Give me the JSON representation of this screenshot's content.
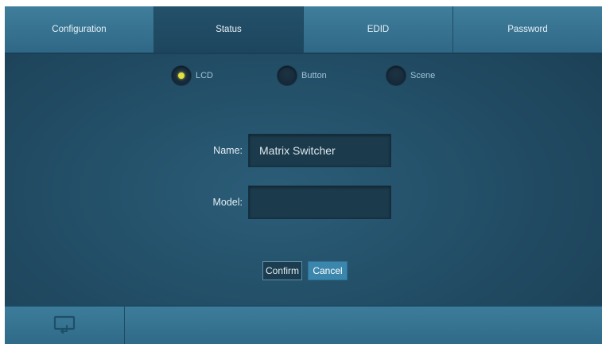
{
  "tabs": [
    {
      "label": "Configuration",
      "active": false
    },
    {
      "label": "Status",
      "active": true
    },
    {
      "label": "EDID",
      "active": false
    },
    {
      "label": "Password",
      "active": false
    }
  ],
  "radios": [
    {
      "label": "LCD",
      "selected": true
    },
    {
      "label": "Button",
      "selected": false
    },
    {
      "label": "Scene",
      "selected": false
    }
  ],
  "form": {
    "name_label": "Name:",
    "name_value": "Matrix Switcher",
    "model_label": "Model:",
    "model_value": ""
  },
  "buttons": {
    "confirm_label": "Confirm",
    "cancel_label": "Cancel"
  },
  "bottom": {
    "icon": "return-screen-icon"
  },
  "colors": {
    "accent": "#3b86ad",
    "selected_dot": "#e2e042",
    "panel": "#214b63"
  }
}
